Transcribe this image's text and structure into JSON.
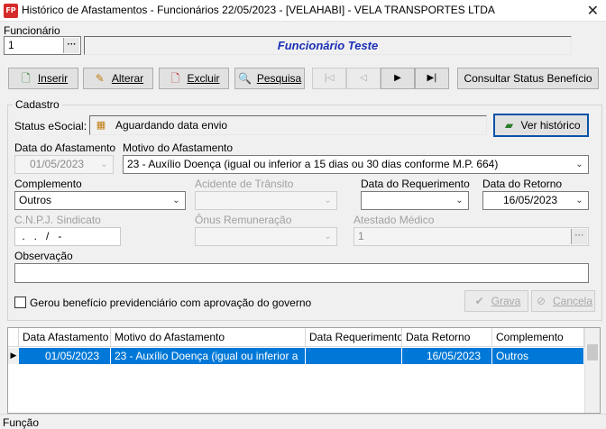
{
  "window": {
    "title": "Histórico de Afastamentos - Funcionários  22/05/2023 - [VELAHABI] - VELA TRANSPORTES LTDA",
    "app_icon_text": "FP",
    "close_glyph": "✕"
  },
  "employee": {
    "label": "Funcionário",
    "code": "1",
    "name": "Funcionário Teste"
  },
  "toolbar": {
    "insert": "Inserir",
    "edit": "Alterar",
    "delete": "Excluir",
    "search": "Pesquisa",
    "consult": "Consultar Status Benefício"
  },
  "nav_glyphs": {
    "first": "|◁",
    "prev": "◁",
    "next": "▶",
    "last": "▶|"
  },
  "cadastro": {
    "caption": "Cadastro",
    "status_label": "Status eSocial:",
    "status_value": "Aguardando data envio",
    "history_button": "Ver histórico",
    "data_afastamento_label": "Data do Afastamento",
    "data_afastamento": "01/05/2023",
    "motivo_label": "Motivo do Afastamento",
    "motivo": "23  -  Auxílio Doença (igual ou inferior a 15 dias ou 30 dias conforme M.P. 664)",
    "complemento_label": "Complemento",
    "complemento": "Outros",
    "acidente_label": "Acidente de Trânsito",
    "acidente": "",
    "data_requerimento_label": "Data do Requerimento",
    "data_requerimento": "",
    "data_retorno_label": "Data do Retorno",
    "data_retorno": "16/05/2023",
    "cnpj_label": "C.N.P.J. Sindicato",
    "cnpj": " .   .   /   -",
    "onus_label": "Ônus Remuneração",
    "onus": "",
    "atestado_label": "Atestado Médico",
    "atestado": "1",
    "observacao_label": "Observação",
    "observacao": "",
    "checkbox_label": "Gerou benefício previdenciário com aprovação do governo",
    "checkbox_checked": false,
    "save_button": "Grava",
    "cancel_button": "Cancela"
  },
  "grid": {
    "columns": [
      "Data Afastamento",
      "Motivo do Afastamento",
      "Data Requerimento",
      "Data Retorno",
      "Complemento"
    ],
    "rows": [
      [
        "01/05/2023",
        "23  -  Auxílio Doença (igual ou inferior a",
        "",
        "16/05/2023",
        "Outros"
      ]
    ]
  },
  "status_bar": {
    "text": "Função"
  },
  "colors": {
    "selection": "#0078d7",
    "employee_name": "#1a2fb5"
  }
}
